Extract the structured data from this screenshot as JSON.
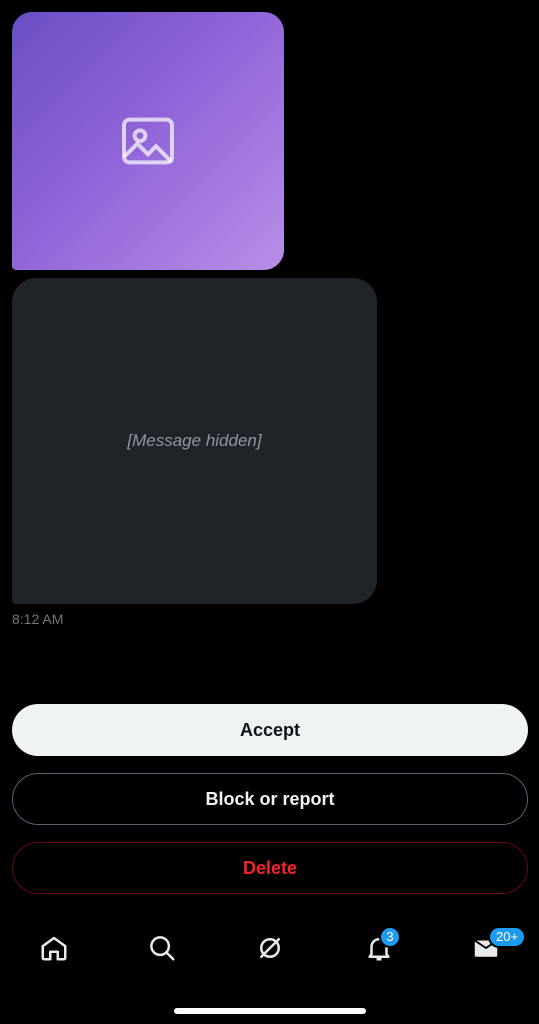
{
  "message": {
    "image_icon": "image-icon",
    "hidden_text": "[Message hidden]",
    "timestamp": "8:12 AM"
  },
  "actions": {
    "accept_label": "Accept",
    "block_label": "Block or report",
    "delete_label": "Delete"
  },
  "nav": {
    "items": [
      {
        "icon": "home-icon"
      },
      {
        "icon": "search-icon"
      },
      {
        "icon": "grok-icon"
      },
      {
        "icon": "bell-icon",
        "badge": "3"
      },
      {
        "icon": "mail-icon",
        "badge": "20+"
      }
    ]
  },
  "colors": {
    "background": "#000000",
    "bubble": "#202327",
    "accent": "#1d9bf0",
    "danger": "#f4212e"
  }
}
